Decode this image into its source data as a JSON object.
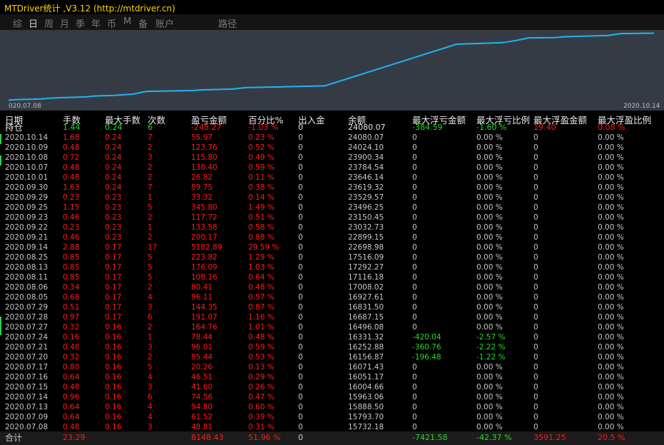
{
  "window": {
    "title": "MTDriver统计 ,V3.12 (http://mtdriver.cn)"
  },
  "tabs": [
    {
      "label": "综",
      "active": false
    },
    {
      "label": "日",
      "active": true
    },
    {
      "label": "周",
      "active": false
    },
    {
      "label": "月",
      "active": false
    },
    {
      "label": "季",
      "active": false
    },
    {
      "label": "年",
      "active": false
    },
    {
      "label": "币",
      "active": false
    },
    {
      "label": "M",
      "active": false
    },
    {
      "label": "备",
      "active": false
    },
    {
      "label": "账户",
      "active": false
    },
    {
      "label": "路径",
      "active": false
    }
  ],
  "chart_data": {
    "type": "line",
    "x_start_label": "020.07.08",
    "x_end_label": "2020.10.14",
    "line_color": "#22b3f0",
    "x": [
      "2020.07.08",
      "2020.07.09",
      "2020.07.13",
      "2020.07.14",
      "2020.07.15",
      "2020.07.16",
      "2020.07.17",
      "2020.07.20",
      "2020.07.21",
      "2020.07.24",
      "2020.07.27",
      "2020.07.28",
      "2020.07.29",
      "2020.08.05",
      "2020.08.06",
      "2020.08.11",
      "2020.08.13",
      "2020.08.25",
      "2020.09.14",
      "2020.09.21",
      "2020.09.22",
      "2020.09.23",
      "2020.09.25",
      "2020.09.29",
      "2020.09.30",
      "2020.10.01",
      "2020.10.07",
      "2020.10.08",
      "2020.10.09",
      "2020.10.14"
    ],
    "values": [
      15732.18,
      15793.7,
      15888.5,
      15963.06,
      16004.66,
      16051.17,
      16071.43,
      16156.87,
      16252.88,
      16331.32,
      16496.08,
      16687.15,
      16831.5,
      16927.61,
      17008.02,
      17116.18,
      17292.27,
      17516.09,
      22698.98,
      22899.15,
      23032.73,
      23150.45,
      23496.25,
      23529.57,
      23619.32,
      23646.14,
      23784.54,
      23900.34,
      24024.1,
      24080.07
    ]
  },
  "table": {
    "headers": [
      "日期",
      "手数",
      "最大手数",
      "次数",
      "盈亏金额",
      "百分比%",
      "出入金",
      "余额",
      "最大浮亏金额",
      "最大浮亏比例",
      "最大浮盈金额",
      "最大浮盈比例"
    ],
    "position_row": [
      "持仓",
      "1.44",
      "0.24",
      "6",
      "-248.27",
      "-1.03 %",
      "0",
      "24080.07",
      "-384.59",
      "-1.60 %",
      "19.40",
      "0.08 %"
    ],
    "rows": [
      [
        "2020.10.14",
        "1.68",
        "0.24",
        "7",
        "55.97",
        "0.23 %",
        "0",
        "24080.07",
        "0",
        "0.00 %",
        "0",
        "0.00 %"
      ],
      [
        "2020.10.09",
        "0.48",
        "0.24",
        "2",
        "123.76",
        "0.52 %",
        "0",
        "24024.10",
        "0",
        "0.00 %",
        "0",
        "0.00 %"
      ],
      [
        "2020.10.08",
        "0.72",
        "0.24",
        "3",
        "115.80",
        "0.49 %",
        "0",
        "23900.34",
        "0",
        "0.00 %",
        "0",
        "0.00 %"
      ],
      [
        "2020.10.07",
        "0.48",
        "0.24",
        "2",
        "138.40",
        "0.59 %",
        "0",
        "23784.54",
        "0",
        "0.00 %",
        "0",
        "0.00 %"
      ],
      [
        "2020.10.01",
        "0.48",
        "0.24",
        "2",
        "26.82",
        "0.11 %",
        "0",
        "23646.14",
        "0",
        "0.00 %",
        "0",
        "0.00 %"
      ],
      [
        "2020.09.30",
        "1.63",
        "0.24",
        "7",
        "89.75",
        "0.38 %",
        "0",
        "23619.32",
        "0",
        "0.00 %",
        "0",
        "0.00 %"
      ],
      [
        "2020.09.29",
        "0.23",
        "0.23",
        "1",
        "33.32",
        "0.14 %",
        "0",
        "23529.57",
        "0",
        "0.00 %",
        "0",
        "0.00 %"
      ],
      [
        "2020.09.25",
        "1.15",
        "0.23",
        "5",
        "345.80",
        "1.49 %",
        "0",
        "23496.25",
        "0",
        "0.00 %",
        "0",
        "0.00 %"
      ],
      [
        "2020.09.23",
        "0.46",
        "0.23",
        "2",
        "117.72",
        "0.51 %",
        "0",
        "23150.45",
        "0",
        "0.00 %",
        "0",
        "0.00 %"
      ],
      [
        "2020.09.22",
        "0.23",
        "0.23",
        "1",
        "133.58",
        "0.58 %",
        "0",
        "23032.73",
        "0",
        "0.00 %",
        "0",
        "0.00 %"
      ],
      [
        "2020.09.21",
        "0.46",
        "0.23",
        "2",
        "200.17",
        "0.88 %",
        "0",
        "22899.15",
        "0",
        "0.00 %",
        "0",
        "0.00 %"
      ],
      [
        "2020.09.14",
        "2.88",
        "0.17",
        "17",
        "5182.89",
        "29.59 %",
        "0",
        "22698.98",
        "0",
        "0.00 %",
        "0",
        "0.00 %"
      ],
      [
        "2020.08.25",
        "0.85",
        "0.17",
        "5",
        "223.82",
        "1.29 %",
        "0",
        "17516.09",
        "0",
        "0.00 %",
        "0",
        "0.00 %"
      ],
      [
        "2020.08.13",
        "0.85",
        "0.17",
        "5",
        "176.09",
        "1.03 %",
        "0",
        "17292.27",
        "0",
        "0.00 %",
        "0",
        "0.00 %"
      ],
      [
        "2020.08.11",
        "0.85",
        "0.17",
        "5",
        "108.16",
        "0.64 %",
        "0",
        "17116.18",
        "0",
        "0.00 %",
        "0",
        "0.00 %"
      ],
      [
        "2020.08.06",
        "0.34",
        "0.17",
        "2",
        "80.41",
        "0.48 %",
        "0",
        "17008.02",
        "0",
        "0.00 %",
        "0",
        "0.00 %"
      ],
      [
        "2020.08.05",
        "0.68",
        "0.17",
        "4",
        "96.11",
        "0.57 %",
        "0",
        "16927.61",
        "0",
        "0.00 %",
        "0",
        "0.00 %"
      ],
      [
        "2020.07.29",
        "0.51",
        "0.17",
        "3",
        "144.35",
        "0.87 %",
        "0",
        "16831.50",
        "0",
        "0.00 %",
        "0",
        "0.00 %"
      ],
      [
        "2020.07.28",
        "0.97",
        "0.17",
        "6",
        "191.07",
        "1.16 %",
        "0",
        "16687.15",
        "0",
        "0.00 %",
        "0",
        "0.00 %"
      ],
      [
        "2020.07.27",
        "0.32",
        "0.16",
        "2",
        "164.76",
        "1.01 %",
        "0",
        "16496.08",
        "0",
        "0.00 %",
        "0",
        "0.00 %"
      ],
      [
        "2020.07.24",
        "0.16",
        "0.16",
        "1",
        "78.44",
        "0.48 %",
        "0",
        "16331.32",
        "-420.04",
        "-2.57 %",
        "0",
        "0.00 %"
      ],
      [
        "2020.07.21",
        "0.48",
        "0.16",
        "3",
        "96.01",
        "0.59 %",
        "0",
        "16252.88",
        "-360.76",
        "-2.22 %",
        "0",
        "0.00 %"
      ],
      [
        "2020.07.20",
        "0.32",
        "0.16",
        "2",
        "85.44",
        "0.53 %",
        "0",
        "16156.87",
        "-196.48",
        "-1.22 %",
        "0",
        "0.00 %"
      ],
      [
        "2020.07.17",
        "0.80",
        "0.16",
        "5",
        "20.26",
        "0.13 %",
        "0",
        "16071.43",
        "0",
        "0.00 %",
        "0",
        "0.00 %"
      ],
      [
        "2020.07.16",
        "0.64",
        "0.16",
        "4",
        "46.51",
        "0.29 %",
        "0",
        "16051.17",
        "0",
        "0.00 %",
        "0",
        "0.00 %"
      ],
      [
        "2020.07.15",
        "0.48",
        "0.16",
        "3",
        "41.60",
        "0.26 %",
        "0",
        "16004.66",
        "0",
        "0.00 %",
        "0",
        "0.00 %"
      ],
      [
        "2020.07.14",
        "0.96",
        "0.16",
        "6",
        "74.56",
        "0.47 %",
        "0",
        "15963.06",
        "0",
        "0.00 %",
        "0",
        "0.00 %"
      ],
      [
        "2020.07.13",
        "0.64",
        "0.16",
        "4",
        "94.80",
        "0.60 %",
        "0",
        "15888.50",
        "0",
        "0.00 %",
        "0",
        "0.00 %"
      ],
      [
        "2020.07.09",
        "0.64",
        "0.16",
        "4",
        "61.52",
        "0.39 %",
        "0",
        "15793.70",
        "0",
        "0.00 %",
        "0",
        "0.00 %"
      ],
      [
        "2020.07.08",
        "0.48",
        "0.16",
        "3",
        "48.81",
        "0.31 %",
        "0",
        "15732.18",
        "0",
        "0.00 %",
        "0",
        "0.00 %"
      ]
    ],
    "total_row": [
      "合计",
      "23.29",
      "",
      "",
      "8148.43",
      "51.96 %",
      "0",
      "",
      "-7421.58",
      "-42.37 %",
      "3591.25",
      "20.5 %"
    ]
  },
  "colors": {
    "red": "#ff1a1a",
    "green": "#22dd22",
    "white": "#e6e6e6",
    "gray": "#c8c8c8"
  }
}
